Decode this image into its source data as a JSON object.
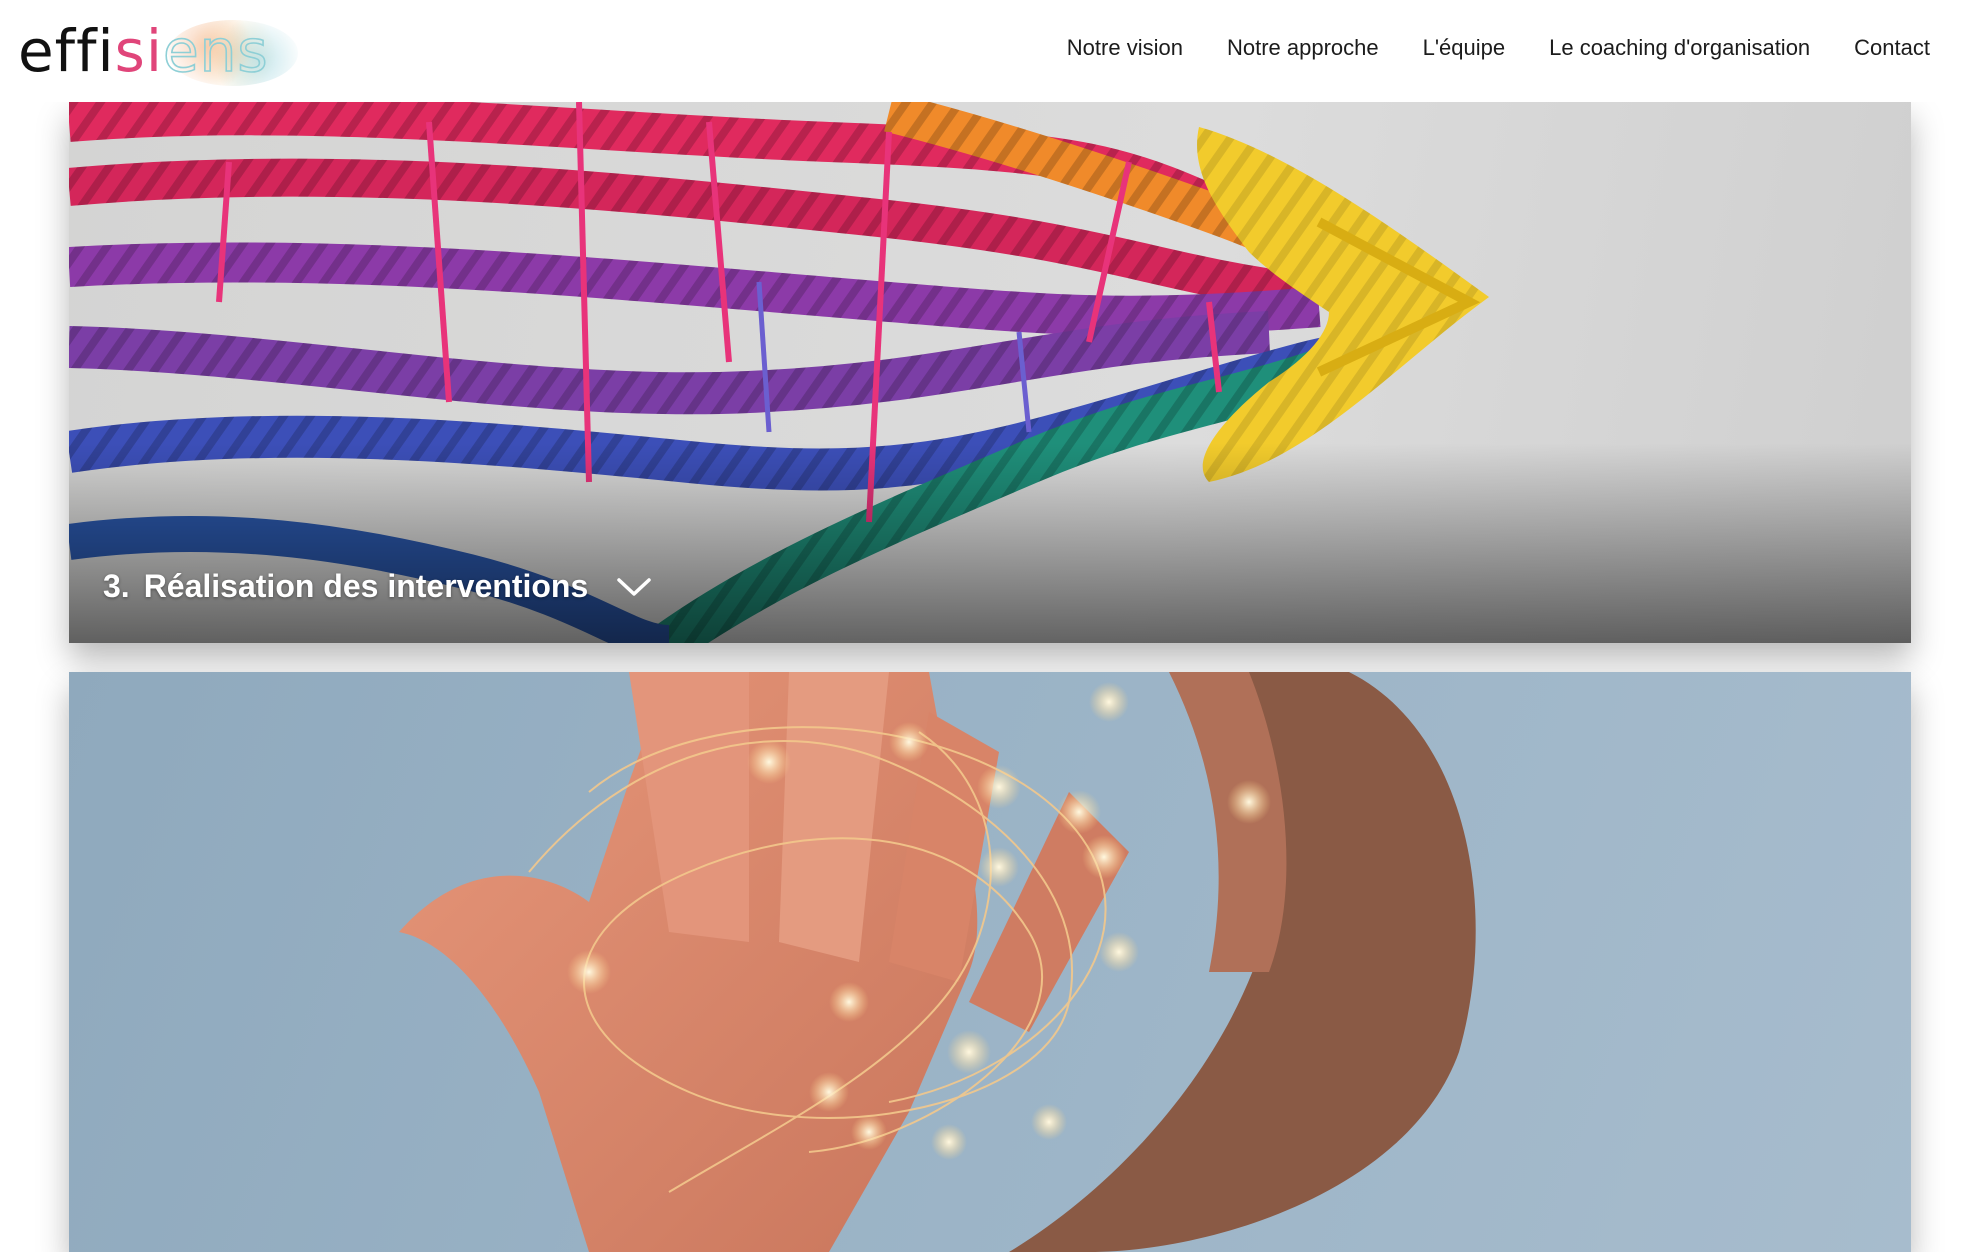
{
  "header": {
    "logo": {
      "part1": "effi",
      "part2": "si",
      "part3": "ens"
    },
    "nav": [
      {
        "label": "Notre vision"
      },
      {
        "label": "Notre approche"
      },
      {
        "label": "L'équipe"
      },
      {
        "label": "Le coaching d'organisation"
      },
      {
        "label": "Contact"
      }
    ]
  },
  "cards": [
    {
      "number": "3.",
      "title": "Réalisation des interventions",
      "image": "colorful-ropes-arrow-image",
      "icon": "chevron-down-icon"
    },
    {
      "image": "hands-fairy-lights-image"
    }
  ],
  "colors": {
    "text_on_image": "#ffffff",
    "nav_text": "#1c1c1c",
    "logo_accent": "#e0457a"
  }
}
